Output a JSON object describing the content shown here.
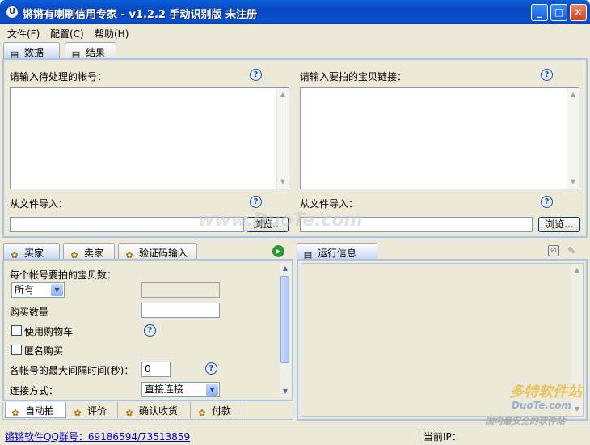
{
  "window": {
    "title": "锵锵有喇刷信用专家 - v1.2.2 手动识别版 未注册",
    "icon_letter": "U"
  },
  "menu": [
    "文件(F)",
    "配置(C)",
    "帮助(H)"
  ],
  "top_tabs": [
    {
      "label": "数据",
      "active": true
    },
    {
      "label": "结果",
      "active": false
    }
  ],
  "data_panel": {
    "accounts_label": "请输入待处理的帐号：",
    "links_label": "请输入要拍的宝贝链接：",
    "import_label": "从文件导入：",
    "browse_button": "浏览..."
  },
  "lower_tabs": [
    {
      "label": "买家",
      "active": true
    },
    {
      "label": "卖家"
    },
    {
      "label": "验证码输入"
    }
  ],
  "buyer": {
    "items_per_account_label": "每个帐号要拍的宝贝数：",
    "items_select": "所有",
    "quantity_label": "购买数量",
    "use_cart_label": "使用购物车",
    "anonymous_label": "匿名购买",
    "max_interval_label": "各帐号的最大间隔时间(秒)：",
    "max_interval_value": "0",
    "connection_label": "连接方式：",
    "connection_value": "直接连接"
  },
  "bottom_tabs": [
    {
      "label": "自动拍",
      "active": true
    },
    {
      "label": "评价"
    },
    {
      "label": "确认收货"
    },
    {
      "label": "付款"
    }
  ],
  "run_info": {
    "title": "运行信息"
  },
  "status": {
    "qq_group": "锵锵软件QQ群号：69186594/73513859",
    "current_ip_label": "当前IP："
  },
  "watermarks": {
    "center": "www.DuoTe.com",
    "logo_cn": "多特软件站",
    "logo_en": "DuoTe.com",
    "slogan": "国内最安全的软件站"
  },
  "icons": {
    "play": "play-icon",
    "clear": "eraser-icon",
    "disable": "no-log-icon",
    "help": "help-icon"
  }
}
